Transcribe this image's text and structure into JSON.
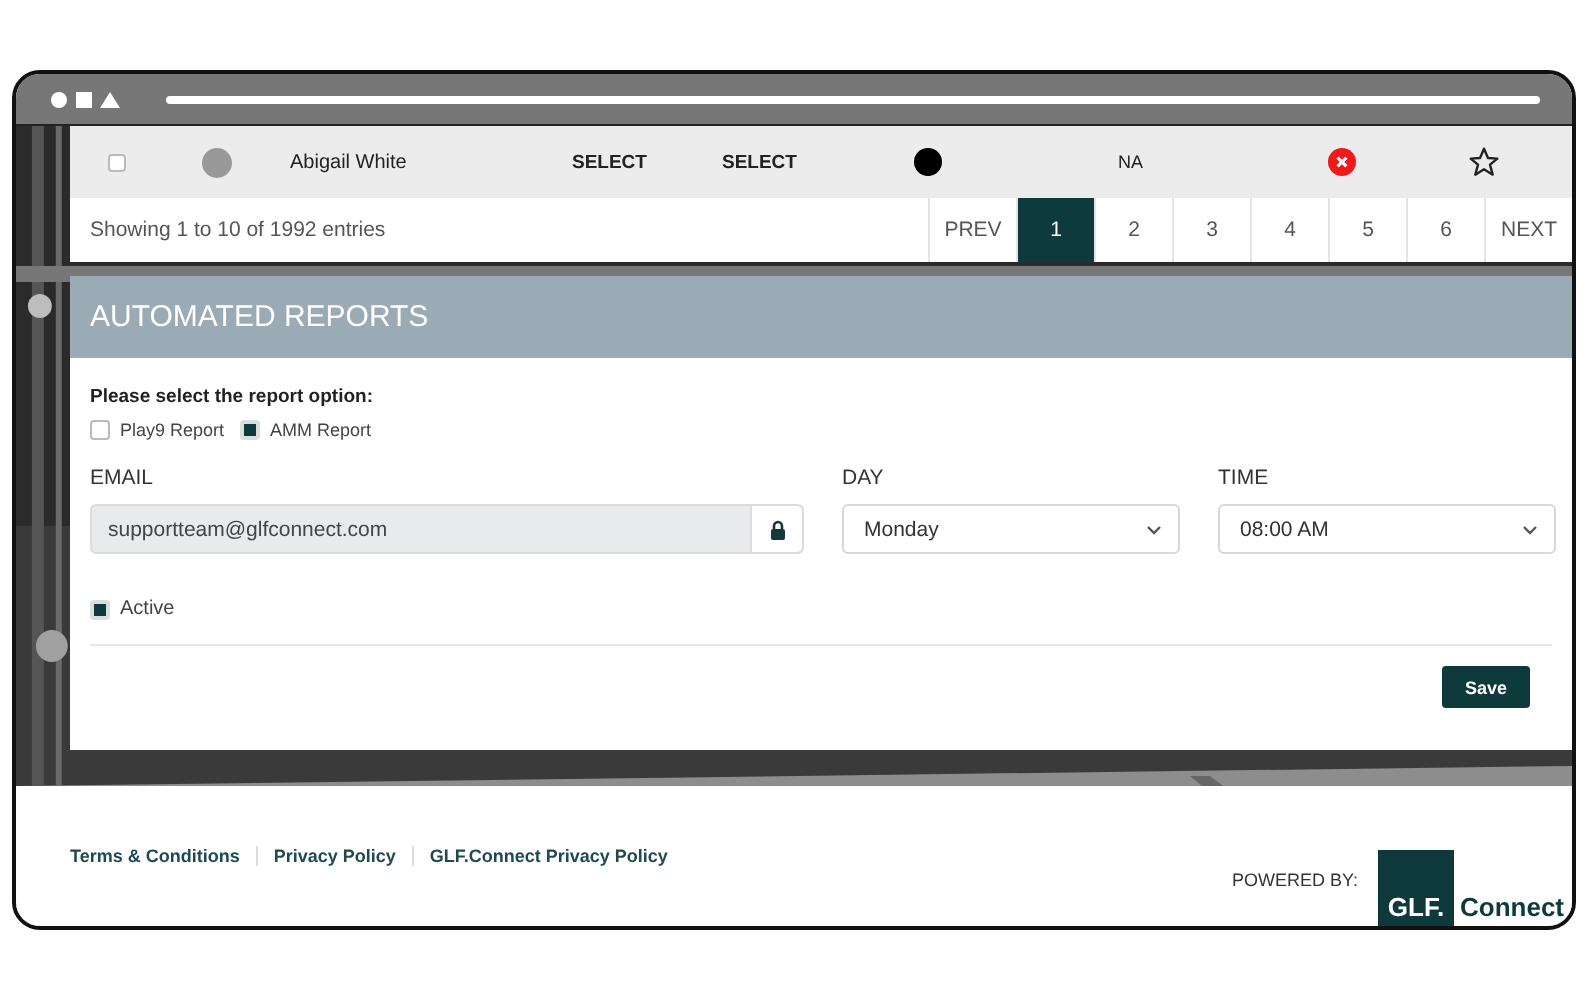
{
  "table_row": {
    "checked": false,
    "name": "Abigail White",
    "column_4": "SELECT",
    "column_5": "SELECT",
    "column_7": "NA",
    "starred": false
  },
  "pagination": {
    "summary": "Showing 1 to 10 of 1992 entries",
    "prev": "PREV",
    "next": "NEXT",
    "pages": [
      {
        "label": "1",
        "selected": true
      },
      {
        "label": "2",
        "selected": false
      },
      {
        "label": "3",
        "selected": false
      },
      {
        "label": "4",
        "selected": false
      },
      {
        "label": "5",
        "selected": false
      },
      {
        "label": "6",
        "selected": false
      }
    ]
  },
  "section_title": "AUTOMATED REPORTS",
  "prompt": "Please select the report option:",
  "report_options": [
    {
      "label": "Play9 Report",
      "checked": false
    },
    {
      "label": "AMM Report",
      "checked": true
    }
  ],
  "email": {
    "label": "EMAIL",
    "value": "supportteam@glfconnect.com",
    "locked": true
  },
  "day": {
    "label": "DAY",
    "value": "Monday"
  },
  "time": {
    "label": "TIME",
    "value": "08:00 AM"
  },
  "active": {
    "label": "Active",
    "checked": true
  },
  "save_button": "Save",
  "footer": {
    "links": [
      "Terms & Conditions",
      "Privacy Policy",
      "GLF.Connect Privacy Policy"
    ],
    "powered_by": "POWERED BY:",
    "logo_mark": "GLF.",
    "logo_word": "Connect"
  }
}
